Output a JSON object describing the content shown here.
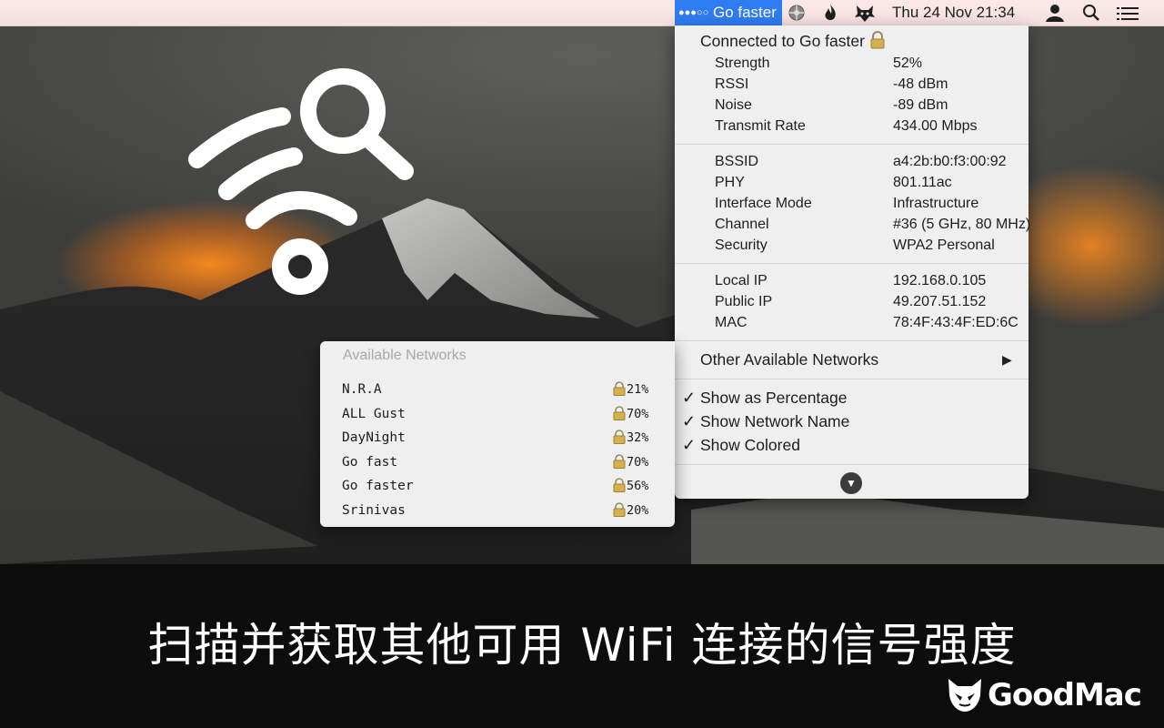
{
  "menubar": {
    "wifi_dots": "●●●○○",
    "wifi_network": "Go faster",
    "datetime": "Thu 24 Nov  21:34",
    "icons": [
      "wheel-icon",
      "flame-icon",
      "cat-icon",
      "user-icon",
      "search-icon",
      "list-icon"
    ]
  },
  "dropdown": {
    "connected_label": "Connected to Go faster",
    "signal": [
      {
        "label": "Strength",
        "value": "52%"
      },
      {
        "label": "RSSI",
        "value": "-48 dBm"
      },
      {
        "label": "Noise",
        "value": "-89 dBm"
      },
      {
        "label": "Transmit Rate",
        "value": "434.00 Mbps"
      }
    ],
    "network": [
      {
        "label": "BSSID",
        "value": "a4:2b:b0:f3:00:92"
      },
      {
        "label": "PHY",
        "value": "801.11ac"
      },
      {
        "label": "Interface Mode",
        "value": "Infrastructure"
      },
      {
        "label": "Channel",
        "value": "#36 (5 GHz, 80 MHz)"
      },
      {
        "label": "Security",
        "value": "WPA2 Personal"
      }
    ],
    "addresses": [
      {
        "label": "Local IP",
        "value": "192.168.0.105"
      },
      {
        "label": "Public IP",
        "value": "49.207.51.152"
      },
      {
        "label": "MAC",
        "value": "78:4F:43:4F:ED:6C"
      }
    ],
    "other_networks": "Other Available Networks",
    "options": [
      {
        "label": "Show as Percentage",
        "checked": true
      },
      {
        "label": "Show Network Name",
        "checked": true
      },
      {
        "label": "Show Colored",
        "checked": true
      }
    ]
  },
  "submenu": {
    "title": "Available Networks",
    "networks": [
      {
        "name": "N.R.A",
        "strength": "21%"
      },
      {
        "name": "ALL Gust",
        "strength": "70%"
      },
      {
        "name": "DayNight",
        "strength": "32%"
      },
      {
        "name": "Go fast",
        "strength": "70%"
      },
      {
        "name": "Go faster",
        "strength": "56%"
      },
      {
        "name": "Srinivas",
        "strength": "20%"
      }
    ]
  },
  "caption": "扫描并获取其他可用 WiFi 连接的信号强度",
  "brand": "GoodMac",
  "colors": {
    "highlight": "#2f7bf2",
    "menu_bg": "#efefef",
    "lock": "#c8a24a"
  }
}
